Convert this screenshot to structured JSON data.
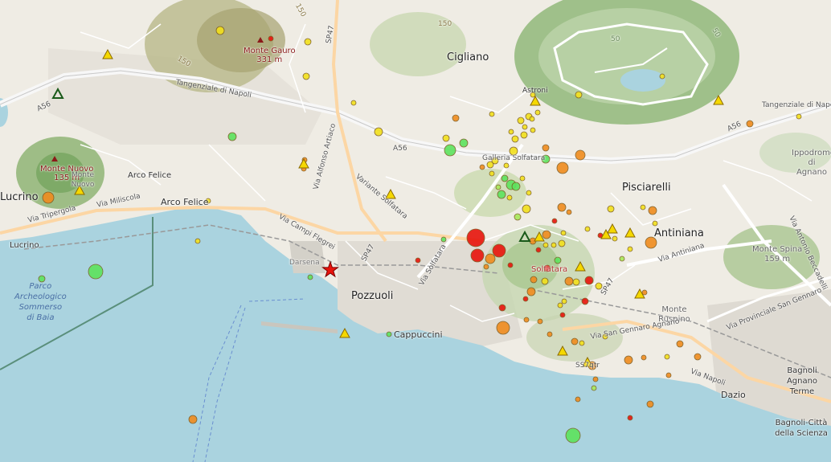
{
  "map": {
    "places": {
      "cigliano": "Cigliano",
      "pisciarelli": "Pisciarelli",
      "antiniana": "Antiniana",
      "pozzuoli": "Pozzuoli",
      "lucrino": "Lucrino",
      "lucrino_stop": "Lucrino",
      "arco_felice": "Arco Felice",
      "arco_felice_stop": "Arco Felice",
      "cappuccini": "Cappuccini",
      "dazio": "Dazio",
      "solfatara": "Solfatara",
      "astroni": "Astroni",
      "ippodromo_agnano": "Ippodromo di Agnano",
      "bagnoli_agnano_terme": "Bagnoli Agnano Terme",
      "bagnoli_citta_scienza": "Bagnoli-Città della Scienza",
      "monte_ruspino": "Monte Ruspino",
      "darsena": "Darsena"
    },
    "peaks": {
      "gauro_name": "Monte Gauro",
      "gauro_elev": "331 m",
      "nuovo_name": "Monte Nuovo",
      "nuovo_elev": "135 m",
      "nuovo_label": "Monte Nuovo",
      "spina_name": "Monte Spina",
      "spina_elev": "159 m"
    },
    "park": {
      "line1": "Parco",
      "line2": "Archeologico",
      "line3": "Sommerso",
      "line4": "di Baia"
    },
    "roads": {
      "tangenziale_west": "Tangenziale di Napoli",
      "tangenziale_east": "Tangenziale di Napoli",
      "a56_west": "A56",
      "a56_mid": "A56",
      "a56_east": "A56",
      "sp47_north": "SP47",
      "sp47_south": "SP47",
      "sp47_east": "SP47",
      "variante_solfatara": "Variante Solfatara",
      "via_campi_flegrei": "Via Campi Flegrei",
      "via_miliscola": "Via Miliscola",
      "via_tripergola": "Via Tripergola",
      "via_alfonso_artiaco": "Via Alfonso Artiaco",
      "via_solfatara": "Via Solfatara",
      "galleria_solfatara": "Galleria Solfatara",
      "via_antiniana": "Via Antiniana",
      "via_san_gennaro_agnano": "Via San Gennaro Agnano",
      "via_provinciale_san_gennaro": "Via Provinciale San Gennaro",
      "via_antonio_beccadelli": "Via Antonio Beccadelli",
      "via_napoli": "Via Napoli",
      "ss7qtr": "SS7qtr",
      "contour_150a": "150",
      "contour_150b": "150",
      "contour_150c": "150",
      "contour_50a": "50",
      "contour_50b": "50"
    },
    "legend_colors": {
      "red": "#e8140c",
      "orange": "#f08c1e",
      "yellow": "#f2e01c",
      "light_green": "#a8e85a",
      "green": "#5de35d",
      "station_triangle": "#f5d800",
      "epicenter_star": "#e8140c"
    }
  }
}
